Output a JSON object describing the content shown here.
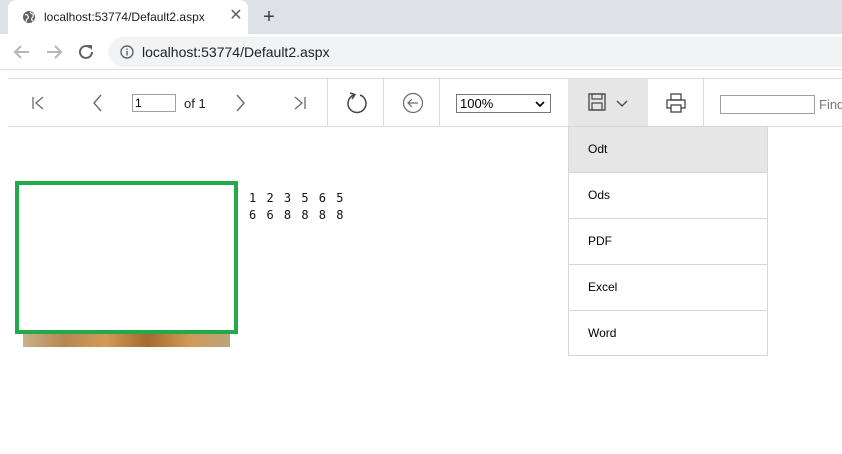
{
  "browser": {
    "tab_title": "localhost:53774/Default2.aspx",
    "new_tab_symbol": "+",
    "close_symbol": "✕",
    "url": "localhost:53774/Default2.aspx"
  },
  "viewer": {
    "page_value": "1",
    "of_label": "of 1",
    "zoom_value": "100%",
    "find_placeholder": "Find"
  },
  "export_menu": {
    "items": [
      {
        "label": "Odt",
        "active": true
      },
      {
        "label": "Ods",
        "active": false
      },
      {
        "label": "PDF",
        "active": false
      },
      {
        "label": "Excel",
        "active": false
      },
      {
        "label": "Word",
        "active": false
      }
    ]
  },
  "report": {
    "line1": "1 2 3 5 6 5",
    "line2": "6 6 8 8 8 8"
  },
  "colors": {
    "highlight_border": "#22aa4a",
    "icon_gray": "#5f6368"
  }
}
